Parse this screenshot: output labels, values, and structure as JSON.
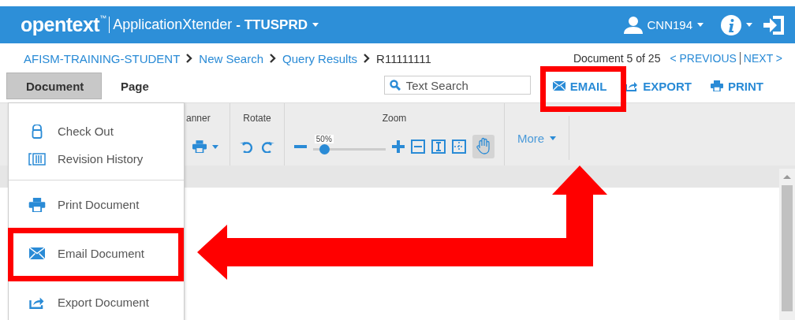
{
  "header": {
    "logo": "opentext",
    "logo_mark": "™",
    "app_title": "ApplicationXtender",
    "repository": "- TTUSPRD",
    "user": "CNN194"
  },
  "breadcrumb": [
    {
      "label": "AFISM-TRAINING-STUDENT",
      "kind": "link"
    },
    {
      "label": "New Search",
      "kind": "link"
    },
    {
      "label": "Query Results",
      "kind": "link"
    },
    {
      "label": "R11111111",
      "kind": "current"
    }
  ],
  "navigation": {
    "position": "Document 5 of 25",
    "previous": "< PREVIOUS",
    "next": "NEXT >"
  },
  "tabs": [
    {
      "label": "Document",
      "selected": true
    },
    {
      "label": "Page",
      "selected": false
    }
  ],
  "search": {
    "placeholder": "Text Search"
  },
  "actions": [
    {
      "label": "EMAIL",
      "kind": "email"
    },
    {
      "label": "EXPORT",
      "kind": "export"
    },
    {
      "label": "PRINT",
      "kind": "print"
    }
  ],
  "toolbar": {
    "scanner_label": "anner",
    "rotate_label": "Rotate",
    "zoom_label": "Zoom",
    "zoom_reading": "50%",
    "level": 0.15,
    "more": "More"
  },
  "menu": [
    [
      {
        "label": "Check Out",
        "kind": "checkout"
      },
      {
        "label": "Revision History",
        "kind": "history"
      }
    ],
    [
      {
        "label": "Print Document",
        "kind": "print"
      }
    ],
    [
      {
        "label": "Email Document",
        "kind": "email"
      }
    ],
    [
      {
        "label": "Export Document",
        "kind": "export"
      }
    ]
  ],
  "annotations": [
    {
      "kind": "frame"
    },
    {
      "kind": "frame"
    },
    {
      "kind": "arrow"
    }
  ]
}
